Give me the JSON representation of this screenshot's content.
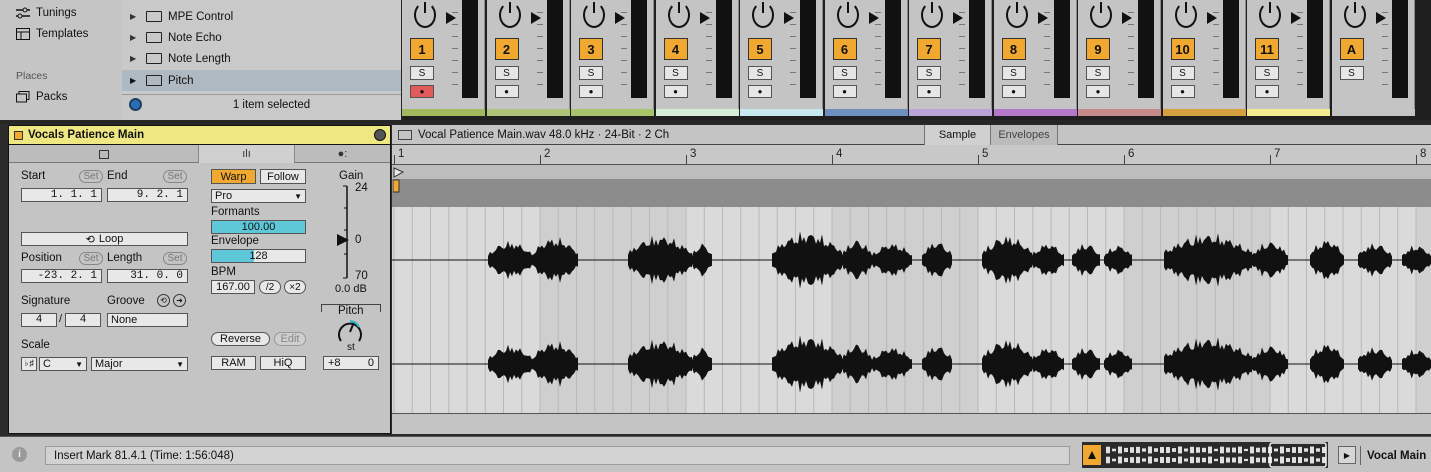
{
  "places": {
    "items": [
      {
        "label": "Tunings",
        "icon": "tunings-icon"
      },
      {
        "label": "Templates",
        "icon": "templates-icon"
      }
    ],
    "section": "Places",
    "packs": "Packs"
  },
  "browser": {
    "items": [
      {
        "label": "MPE Control",
        "selected": false
      },
      {
        "label": "Note Echo",
        "selected": false
      },
      {
        "label": "Note Length",
        "selected": false
      },
      {
        "label": "Pitch",
        "selected": true
      }
    ],
    "status": "1 item selected"
  },
  "mixer": {
    "channels": [
      {
        "num": "1",
        "color": "#a3b85c",
        "armed": true
      },
      {
        "num": "2",
        "color": "#b0c37a",
        "armed": false
      },
      {
        "num": "3",
        "color": "#a8c46a",
        "armed": false
      },
      {
        "num": "4",
        "color": "#d4ecd8",
        "armed": false
      },
      {
        "num": "5",
        "color": "#c8e8f0",
        "armed": false
      },
      {
        "num": "6",
        "color": "#6f8fbf",
        "armed": false
      },
      {
        "num": "7",
        "color": "#b9a4d8",
        "armed": false
      },
      {
        "num": "8",
        "color": "#b478c8",
        "armed": false
      },
      {
        "num": "9",
        "color": "#c78a8a",
        "armed": false
      },
      {
        "num": "10",
        "color": "#d4a040",
        "armed": false
      },
      {
        "num": "11",
        "color": "#f4ea90",
        "armed": false
      },
      {
        "num": "A",
        "color": "#c4c4c4",
        "armed": false
      }
    ],
    "solo_label": "S"
  },
  "clip": {
    "name": "Vocals Patience Main",
    "start_label": "Start",
    "end_label": "End",
    "set_label": "Set",
    "start_value": "1.  1.  1",
    "end_value": "9.  2.  1",
    "loop_label": "Loop",
    "position_label": "Position",
    "length_label": "Length",
    "position_value": "-23.  2.  1",
    "length_value": "31.  0.  0",
    "signature_label": "Signature",
    "groove_label": "Groove",
    "sig_num": "4",
    "sig_den": "4",
    "groove_value": "None",
    "scale_label": "Scale",
    "scale_root": "C",
    "scale_mode": "Major",
    "warp_label": "Warp",
    "follow_label": "Follow",
    "warp_mode": "Pro",
    "formants_label": "Formants",
    "formants_value": "100.00",
    "envelope_label": "Envelope",
    "envelope_value": "128",
    "bpm_label": "BPM",
    "bpm_value": "167.00",
    "half_label": "/2",
    "double_label": "×2",
    "reverse_label": "Reverse",
    "edit_label": "Edit",
    "ram_label": "RAM",
    "hiq_label": "HiQ",
    "gain_label": "Gain",
    "gain_top": "24",
    "gain_zero": "0",
    "gain_bottom": "70",
    "gain_value": "0.0 dB",
    "pitch_label": "Pitch",
    "pitch_unit": "st",
    "pitch_st": "+8",
    "pitch_cents": "0"
  },
  "sample": {
    "file_info": "Vocal Patience Main.wav  48.0 kHz · 24-Bit · 2 Ch",
    "tab_sample": "Sample",
    "tab_envelopes": "Envelopes",
    "bars": [
      "1",
      "2",
      "3",
      "4",
      "5",
      "6",
      "7",
      "8"
    ]
  },
  "status": {
    "info_icon": "i",
    "message": "Insert Mark 81.4.1 (Time: 1:56:048)",
    "track_name": "Vocal Main"
  }
}
